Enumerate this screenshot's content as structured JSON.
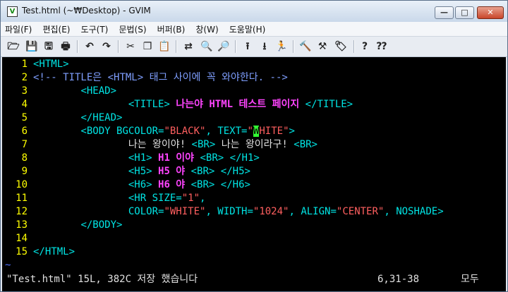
{
  "window": {
    "title": "Test.html (~₩Desktop) - GVIM",
    "app_icon_glyph": "V",
    "controls": {
      "minimize": "—",
      "maximize": "□",
      "close": "✕"
    }
  },
  "menu": [
    "파일(F)",
    "편집(E)",
    "도구(T)",
    "문법(S)",
    "버퍼(B)",
    "창(W)",
    "도움말(H)"
  ],
  "toolbar_icons": [
    "open-icon",
    "save-icon",
    "save-all-icon",
    "print-icon",
    "undo-icon",
    "redo-icon",
    "cut-icon",
    "copy-icon",
    "paste-icon",
    "find-replace-icon",
    "find-next-icon",
    "find-prev-icon",
    "load-session-icon",
    "save-session-icon",
    "run-script-icon",
    "make-icon",
    "ctags-icon",
    "tag-jump-icon",
    "help-icon",
    "help-search-icon"
  ],
  "code_lines": [
    [
      {
        "t": "<HTML>",
        "c": "tg"
      }
    ],
    [
      {
        "t": "<!-- TITLE은 <HTML> 태그 사이에 꼭 와야한다. -->",
        "c": "cm"
      }
    ],
    [
      {
        "t": "        "
      },
      {
        "t": "<HEAD>",
        "c": "tg"
      }
    ],
    [
      {
        "t": "                "
      },
      {
        "t": "<TITLE>",
        "c": "tg"
      },
      {
        "t": " "
      },
      {
        "t": "나는야 HTML 테스트 페이지",
        "c": "mg"
      },
      {
        "t": " "
      },
      {
        "t": "</TITLE>",
        "c": "tg"
      }
    ],
    [
      {
        "t": "        "
      },
      {
        "t": "</HEAD>",
        "c": "tg"
      }
    ],
    [
      {
        "t": "        "
      },
      {
        "t": "<BODY BGCOLOR=",
        "c": "tg"
      },
      {
        "t": "\"BLACK\"",
        "c": "st"
      },
      {
        "t": ", TEXT=",
        "c": "tg"
      },
      {
        "t": "\"",
        "c": "st"
      },
      {
        "t": "W",
        "c": "cursor"
      },
      {
        "t": "HITE\"",
        "c": "st"
      },
      {
        "t": ">",
        "c": "tg"
      }
    ],
    [
      {
        "t": "                "
      },
      {
        "t": "나는 왕이야! ",
        "c": "tx"
      },
      {
        "t": "<BR>",
        "c": "tg"
      },
      {
        "t": " 나는 왕이라구! ",
        "c": "tx"
      },
      {
        "t": "<BR>",
        "c": "tg"
      }
    ],
    [
      {
        "t": "                "
      },
      {
        "t": "<H1>",
        "c": "tg"
      },
      {
        "t": " "
      },
      {
        "t": "H1 이야",
        "c": "mg"
      },
      {
        "t": " "
      },
      {
        "t": "<BR>",
        "c": "tg"
      },
      {
        "t": " "
      },
      {
        "t": "</H1>",
        "c": "tg"
      }
    ],
    [
      {
        "t": "                "
      },
      {
        "t": "<H5>",
        "c": "tg"
      },
      {
        "t": " "
      },
      {
        "t": "H5 야",
        "c": "mg"
      },
      {
        "t": " "
      },
      {
        "t": "<BR>",
        "c": "tg"
      },
      {
        "t": " "
      },
      {
        "t": "</H5>",
        "c": "tg"
      }
    ],
    [
      {
        "t": "                "
      },
      {
        "t": "<H6>",
        "c": "tg"
      },
      {
        "t": " "
      },
      {
        "t": "H6 야",
        "c": "mg"
      },
      {
        "t": " "
      },
      {
        "t": "<BR>",
        "c": "tg"
      },
      {
        "t": " "
      },
      {
        "t": "</H6>",
        "c": "tg"
      }
    ],
    [
      {
        "t": "                "
      },
      {
        "t": "<HR SIZE=",
        "c": "tg"
      },
      {
        "t": "\"1\"",
        "c": "st"
      },
      {
        "t": ",",
        "c": "tg"
      }
    ],
    [
      {
        "t": "                "
      },
      {
        "t": "COLOR=",
        "c": "tg"
      },
      {
        "t": "\"WHITE\"",
        "c": "st"
      },
      {
        "t": ", WIDTH=",
        "c": "tg"
      },
      {
        "t": "\"1024\"",
        "c": "st"
      },
      {
        "t": ", ALIGN=",
        "c": "tg"
      },
      {
        "t": "\"CENTER\"",
        "c": "st"
      },
      {
        "t": ", NOSHADE>",
        "c": "tg"
      }
    ],
    [
      {
        "t": "        "
      },
      {
        "t": "</BODY>",
        "c": "tg"
      }
    ],
    [],
    [
      {
        "t": "</HTML>",
        "c": "tg"
      }
    ]
  ],
  "empty_line_marker": "~",
  "status": {
    "message": "\"Test.html\" 15L, 382C 저장 했습니다",
    "position": "6,31-38",
    "scroll": "모두"
  },
  "colors": {
    "editor_bg": "#000000",
    "line_number": "#ffff00",
    "tag": "#00e5e5",
    "title_text": "#ff44ff",
    "string": "#ff5f5f",
    "comment": "#7f9fff",
    "cursor": "#33ff33"
  }
}
